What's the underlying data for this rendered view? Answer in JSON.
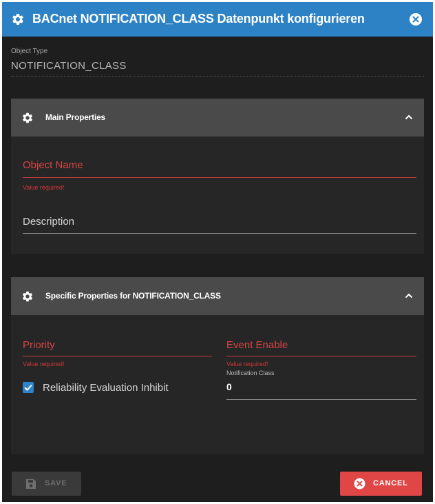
{
  "dialog": {
    "title": "BACnet NOTIFICATION_CLASS Datenpunkt konfigurieren",
    "accent_color": "#2c82c4",
    "title_icon": "gear-icon",
    "close_icon": "close-icon"
  },
  "object_type": {
    "label": "Object Type",
    "value": "NOTIFICATION_CLASS"
  },
  "main_properties": {
    "title": "Main Properties",
    "icon": "gear-icon",
    "expanded": true,
    "object_name": {
      "placeholder": "Object Name",
      "error": "Value required!"
    },
    "description": {
      "placeholder": "Description"
    }
  },
  "specific_properties": {
    "title": "Specific Properties for NOTIFICATION_CLASS",
    "icon": "gear-icon",
    "expanded": true,
    "priority": {
      "placeholder": "Priority",
      "error": "Value required!"
    },
    "event_enable": {
      "placeholder": "Event Enable",
      "error": "Value required!"
    },
    "reliability_evaluation_inhibit": {
      "label": "Reliability Evaluation Inhibit",
      "checked": true
    },
    "notification_class": {
      "label": "Notification Class",
      "value": "0"
    }
  },
  "footer": {
    "save_label": "SAVE",
    "save_enabled": false,
    "cancel_label": "CANCEL",
    "cancel_color": "#e14646",
    "error_color": "#d84545"
  }
}
